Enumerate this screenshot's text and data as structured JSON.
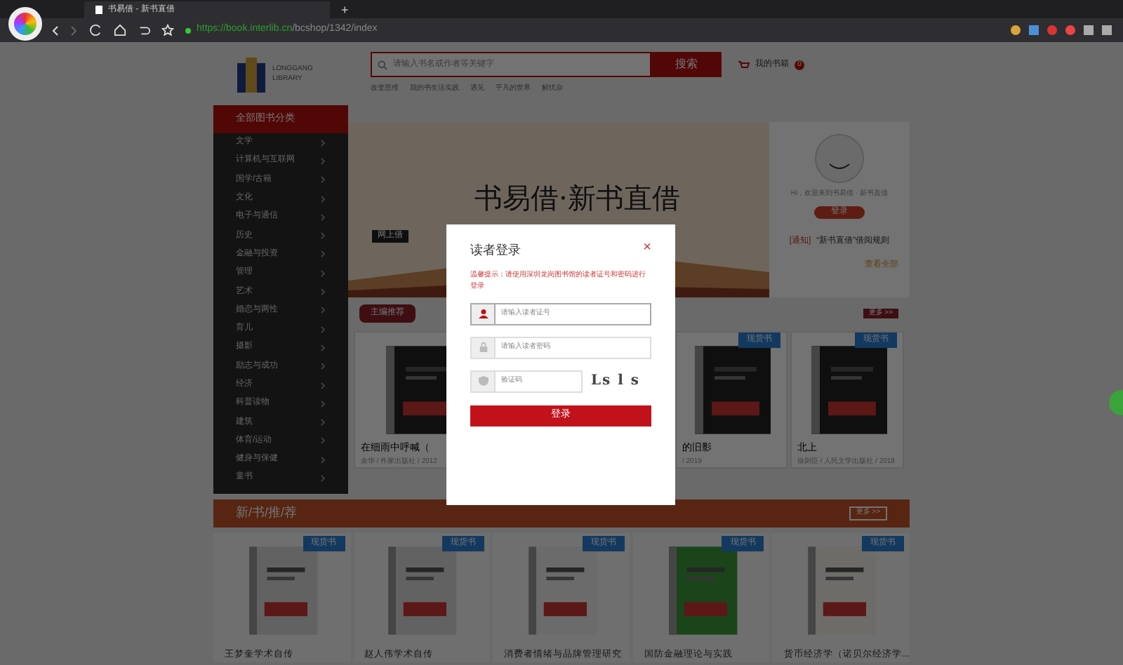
{
  "browser": {
    "tab_title": "书易借 - 新书直借",
    "url_host": "https://book.interlib.cn",
    "url_path": "/bcshop/1342/index",
    "new_tab": "+"
  },
  "header": {
    "logo_line1": "LONGGANG",
    "logo_line2": "LIBRARY",
    "search_placeholder": "请输入书名或作者等关键字",
    "search_button": "搜索",
    "cart_label": "我的书箱",
    "cart_count": "0",
    "hot_links": [
      "改变思维",
      "我的书生活实践",
      "遇见",
      "平凡的世界",
      "解忧杂"
    ]
  },
  "sidebar": {
    "title": "全部图书分类",
    "items": [
      "文学",
      "计算机与互联网",
      "国学/古籍",
      "文化",
      "电子与通信",
      "历史",
      "金融与投资",
      "管理",
      "艺术",
      "婚恋与两性",
      "育儿",
      "摄影",
      "励志与成功",
      "经济",
      "科普读物",
      "建筑",
      "体育/运动",
      "健身与保健",
      "童书"
    ]
  },
  "banner": {
    "brand": "书易借·新书直借",
    "tag": "网上借"
  },
  "user_panel": {
    "greeting": "Hi，欢迎来到书易借 · 新书直借",
    "login_button": "登录",
    "notice_tag": "[通知]",
    "notice_text": "“新书直借”借阅规则",
    "view_all": "查看全部"
  },
  "editor_picks": {
    "title": "主编推荐",
    "more": "更多 >>",
    "books": [
      {
        "title": "在细雨中呼喊（",
        "meta": "余华 / 作家出版社 / 2012"
      },
      {
        "ribbon": "现货书",
        "title": "的旧影",
        "meta": "/ 2019"
      },
      {
        "ribbon": "现货书",
        "title": "北上",
        "meta": "徐则臣 / 人民文学出版社 / 2018"
      }
    ]
  },
  "new_books": {
    "title": "新/书/推/荐",
    "more": "更多 >>",
    "books": [
      {
        "ribbon": "现货书",
        "title": "王梦奎学术自传"
      },
      {
        "ribbon": "现货书",
        "title": "赵人伟学术自传"
      },
      {
        "ribbon": "现货书",
        "title": "消费者情绪与品牌管理研究"
      },
      {
        "ribbon": "现货书",
        "title": "国防金融理论与实践"
      },
      {
        "ribbon": "现货书",
        "title": "货币经济学（诺贝尔经济学..."
      }
    ]
  },
  "login_dialog": {
    "title": "读者登录",
    "close": "×",
    "hint": "温馨提示：请使用深圳龙岗图书馆的读者证号和密码进行登录",
    "card_placeholder": "请输入读者证号",
    "password_placeholder": "请输入读者密码",
    "captcha_placeholder": "验证码",
    "captcha_text": "Ls l s",
    "submit": "登录"
  }
}
